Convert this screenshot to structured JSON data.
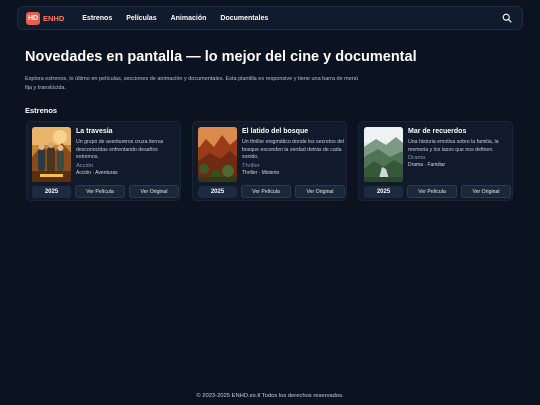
{
  "nav": {
    "logo_badge": "HD",
    "logo_text": "ENHD",
    "links": [
      "Estrenos",
      "Películas",
      "Animación",
      "Documentales"
    ],
    "search_icon": "search-icon"
  },
  "hero": {
    "title": "Novedades en pantalla — lo mejor del cine y documental",
    "description": "Explora estrenos, lo último en películas, secciones de animación y documentales. Esta plantilla es responsive y tiene una barra de menú fija y translúcida."
  },
  "section": {
    "title": "Estrenos"
  },
  "cards": [
    {
      "title": "La travesía",
      "description": "Un grupo de aventureros cruza tierras desconocidas enfrentando desafíos extremos.",
      "genre": "Acción",
      "tags": "Acción · Aventuras",
      "year": "2025",
      "btn_movie": "Ver Película",
      "btn_original": "Ver Original"
    },
    {
      "title": "El latido del bosque",
      "description": "Un thriller enigmático donde los secretos del bosque esconden la verdad detrás de cada sonido.",
      "genre": "Thriller",
      "tags": "Thriller · Misterio",
      "year": "2025",
      "btn_movie": "Ver Película",
      "btn_original": "Ver Original"
    },
    {
      "title": "Mar de recuerdos",
      "description": "Una historia emotiva sobre la familia, la memoria y los lazos que nos definen.",
      "genre": "Drama",
      "tags": "Drama · Familiar",
      "year": "2025",
      "btn_movie": "Ver Película",
      "btn_original": "Ver Original"
    }
  ],
  "footer": {
    "text": "© 2023-2025 ENHD.es.tl Todos los derechos reservados."
  },
  "colors": {
    "background": "#0b1220",
    "accent": "#e8604c",
    "card": "#111a2b"
  }
}
